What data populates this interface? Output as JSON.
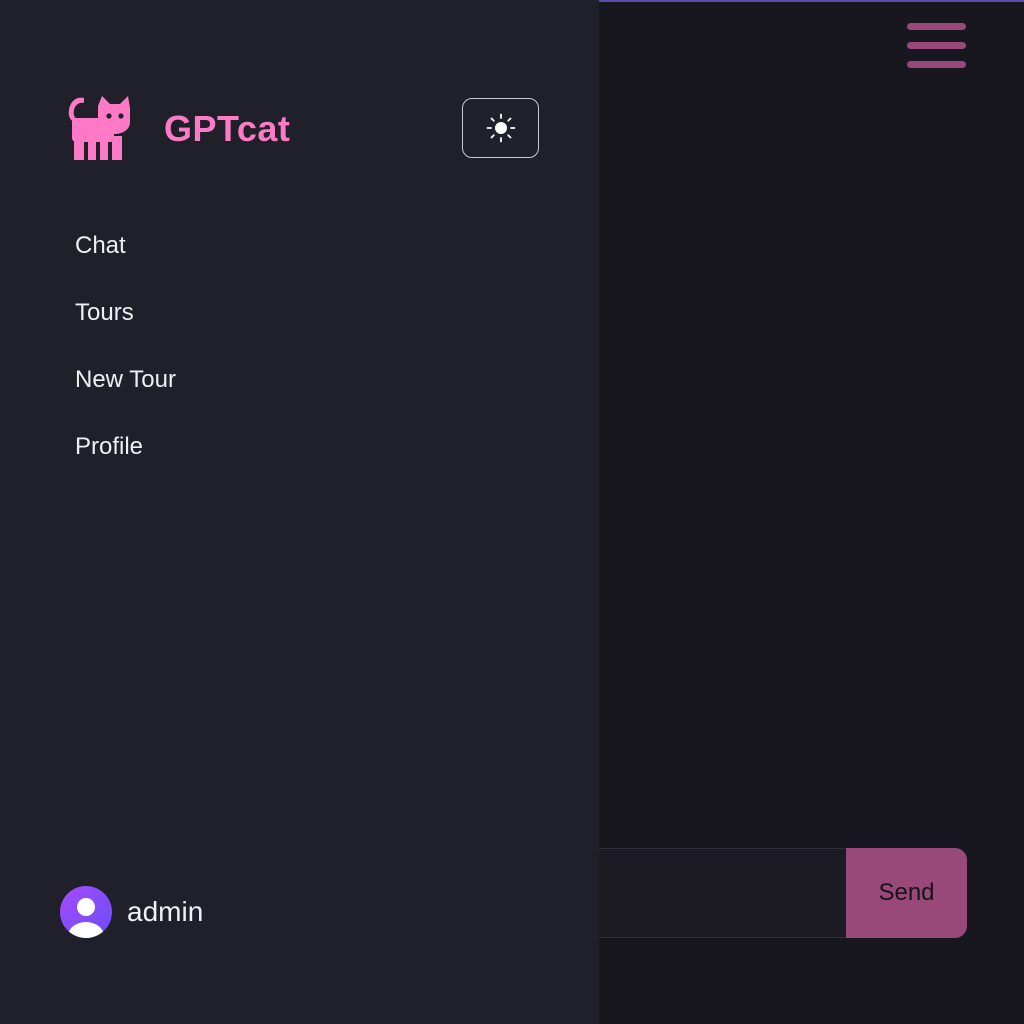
{
  "app": {
    "brand": "GPTcat"
  },
  "icons": {
    "logo": "cat-icon",
    "theme": "sun-icon",
    "menu": "hamburger-menu-icon",
    "avatar": "user-avatar-icon"
  },
  "colors": {
    "brand_pink": "#ff7ac6",
    "accent": "#98497a",
    "sidebar_bg": "#20202a",
    "main_bg": "#18171f"
  },
  "sidebar": {
    "nav": [
      {
        "label": "Chat"
      },
      {
        "label": "Tours"
      },
      {
        "label": "New Tour"
      },
      {
        "label": "Profile"
      }
    ],
    "user": {
      "name": "admin"
    }
  },
  "chat": {
    "input_value": "",
    "send_label": "Send"
  }
}
